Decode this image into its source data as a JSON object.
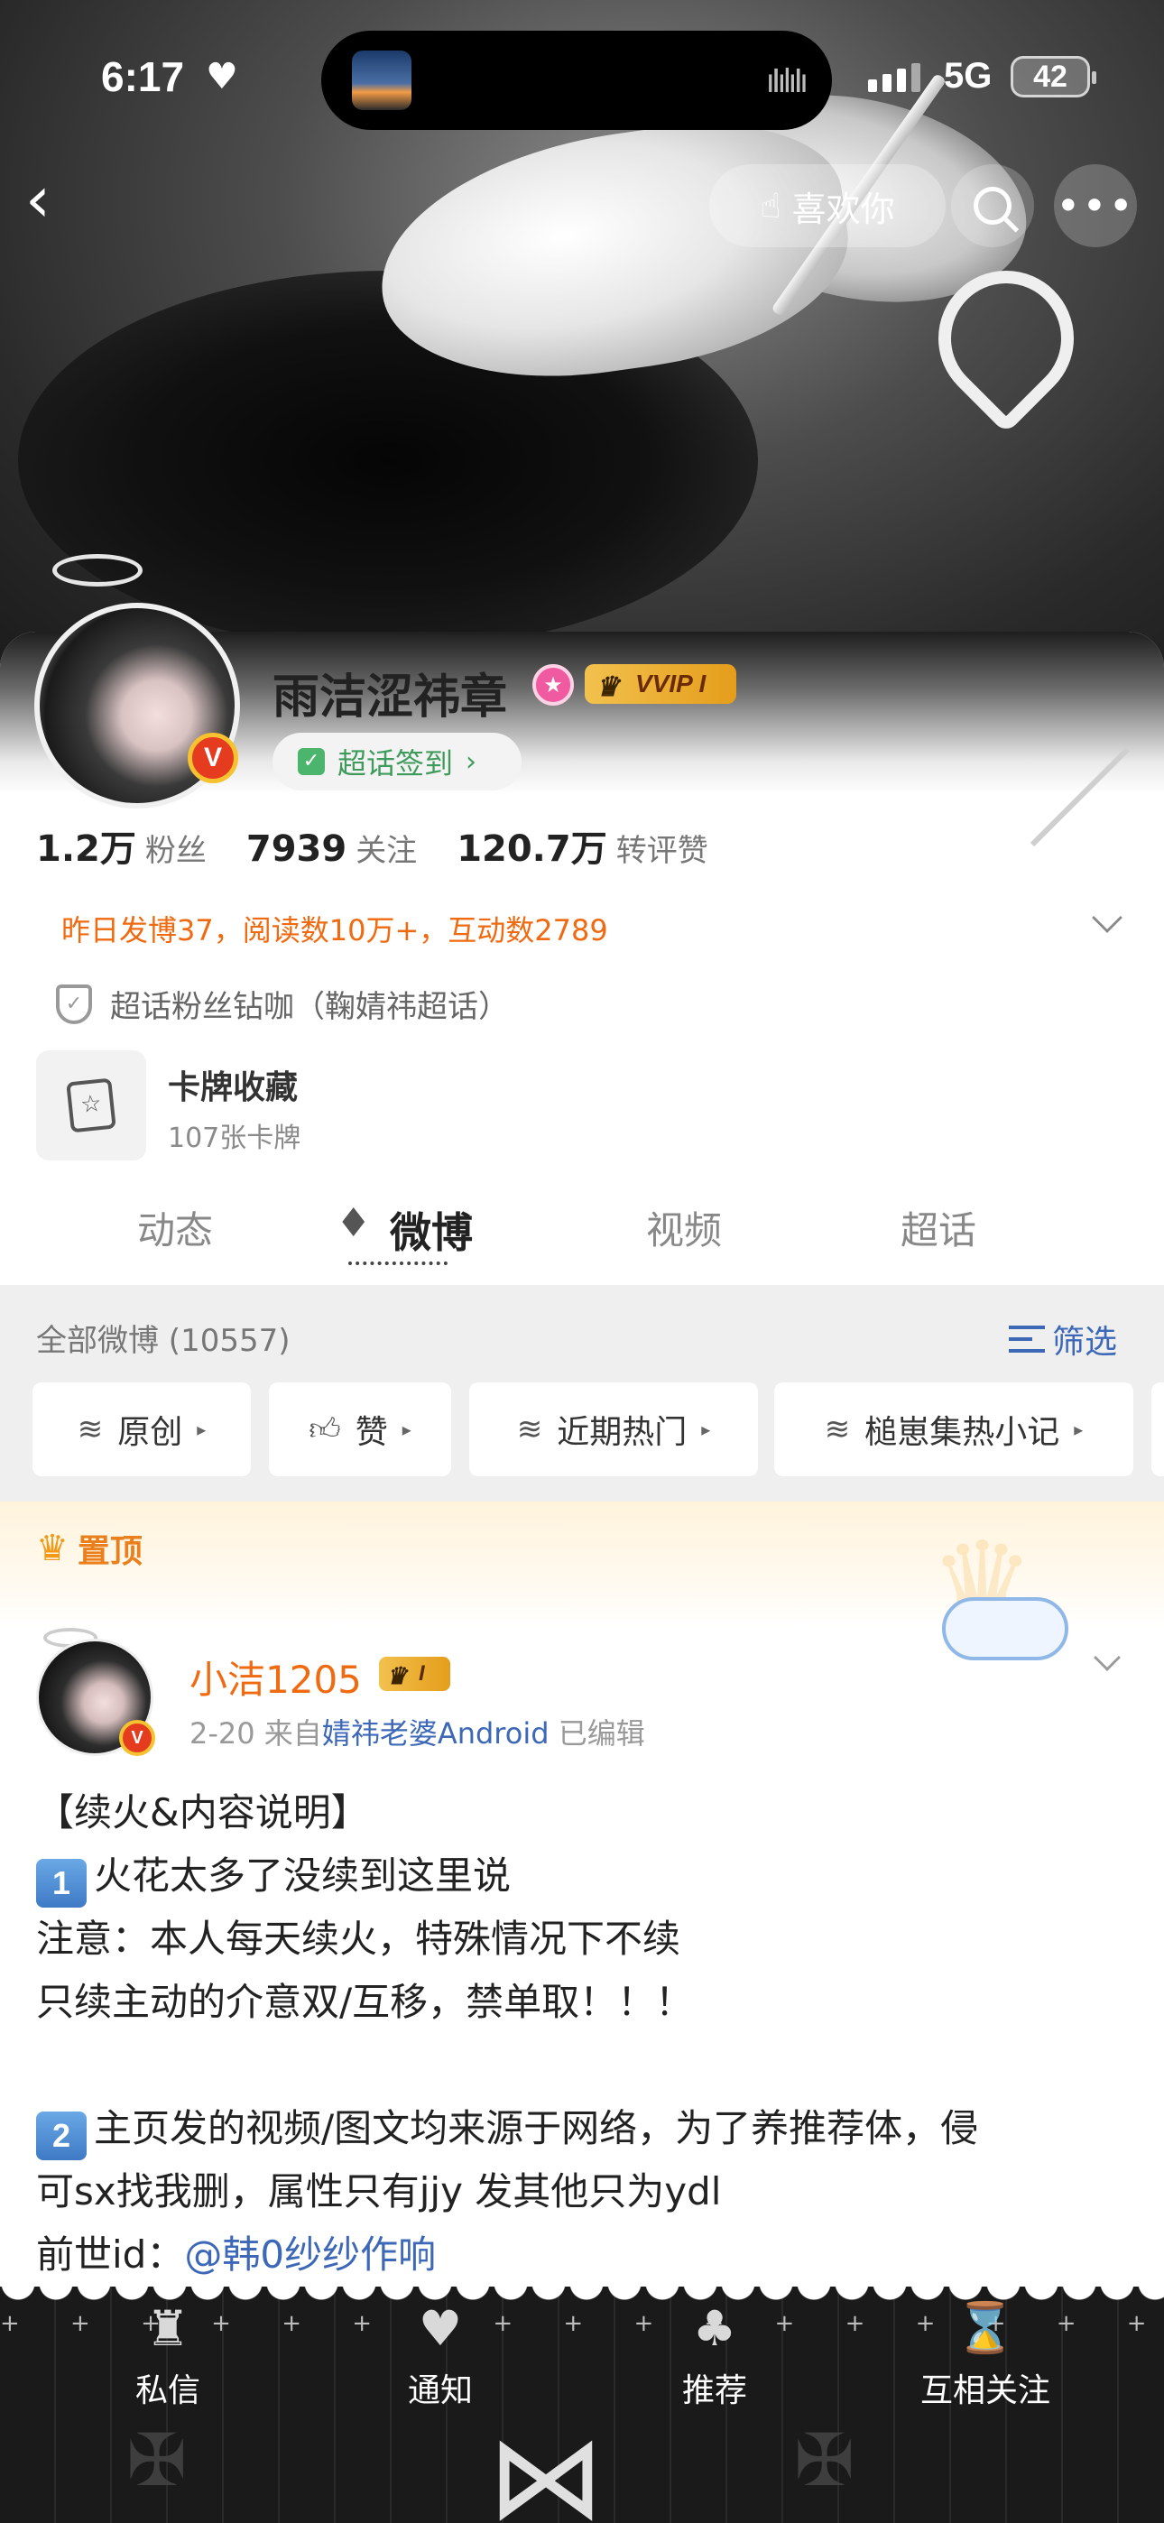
{
  "status_bar": {
    "time": "6:17",
    "network": "5G",
    "battery": "42"
  },
  "header": {
    "like_button": "喜欢你"
  },
  "profile": {
    "name": "雨洁涩祎章",
    "vip_badge": "VVIP I",
    "checkin": "超话签到",
    "stats": [
      {
        "value": "1.2万",
        "label": "粉丝"
      },
      {
        "value": "7939",
        "label": "关注"
      },
      {
        "value": "120.7万",
        "label": "转评赞"
      }
    ],
    "activity": "昨日发博37，阅读数10万+，互动数2789",
    "fan_title": "超话粉丝钻咖（鞠婧祎超话）",
    "cards": {
      "title": "卡牌收藏",
      "count": "107张卡牌"
    }
  },
  "tabs": [
    "动态",
    "微博",
    "视频",
    "超话"
  ],
  "filter": {
    "all_label": "全部微博 (10557)",
    "filter_button": "筛选",
    "chips": [
      "原创",
      "赞",
      "近期热门",
      "槌崽集热小记"
    ]
  },
  "pinned": {
    "label": "置顶",
    "author": "小洁1205",
    "level": "I",
    "date": "2-20",
    "source_prefix": "来自",
    "source": "婧祎老婆Android",
    "edited": "已编辑",
    "lines": {
      "l1": "【续火&内容说明】",
      "l2_num": "1",
      "l2": "火花太多了没续到这里说",
      "l3": "注意：本人每天续火，特殊情况下不续",
      "l4": "只续主动的介意双/互移，禁单取！！！",
      "l5_num": "2",
      "l5": "主页发的视频/图文均来源于网络，为了养推荐体，侵",
      "l6": "可sx找我删，属性只有jjy 发其他只为ydl",
      "l7_prefix": "前世id：",
      "l7_mention": "@韩0纱纱作响"
    }
  },
  "bottom_nav": [
    "私信",
    "通知",
    "推荐",
    "互相关注"
  ]
}
